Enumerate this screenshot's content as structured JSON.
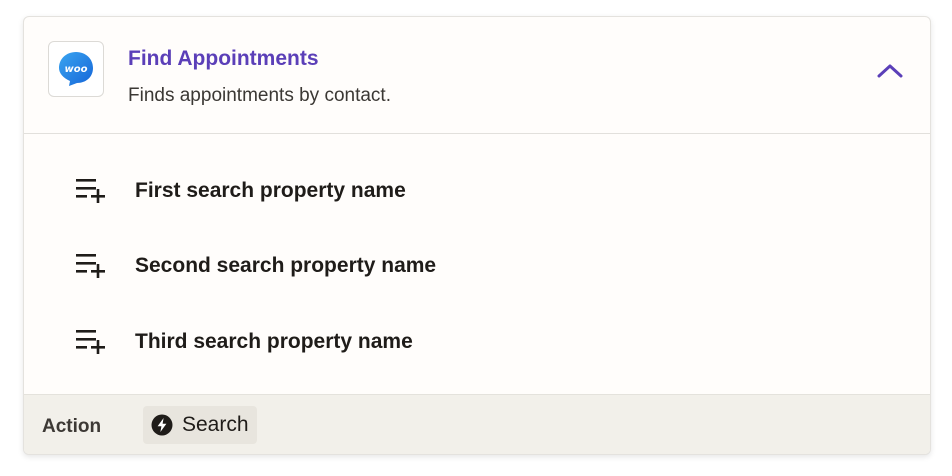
{
  "step": {
    "title": "Find Appointments",
    "description": "Finds appointments by contact.",
    "app_icon": "woo-logo",
    "app_icon_text": "woo",
    "collapse_icon": "chevron-up-icon"
  },
  "fields": [
    {
      "label": "First search property name",
      "icon": "add-list-icon"
    },
    {
      "label": "Second search property name",
      "icon": "add-list-icon"
    },
    {
      "label": "Third search property name",
      "icon": "add-list-icon"
    }
  ],
  "footer": {
    "label": "Action",
    "type_label": "Search",
    "type_icon": "lightning-bolt-icon"
  },
  "colors": {
    "accent": "#5b3fb8",
    "woo_blue": "#1e88e5"
  }
}
